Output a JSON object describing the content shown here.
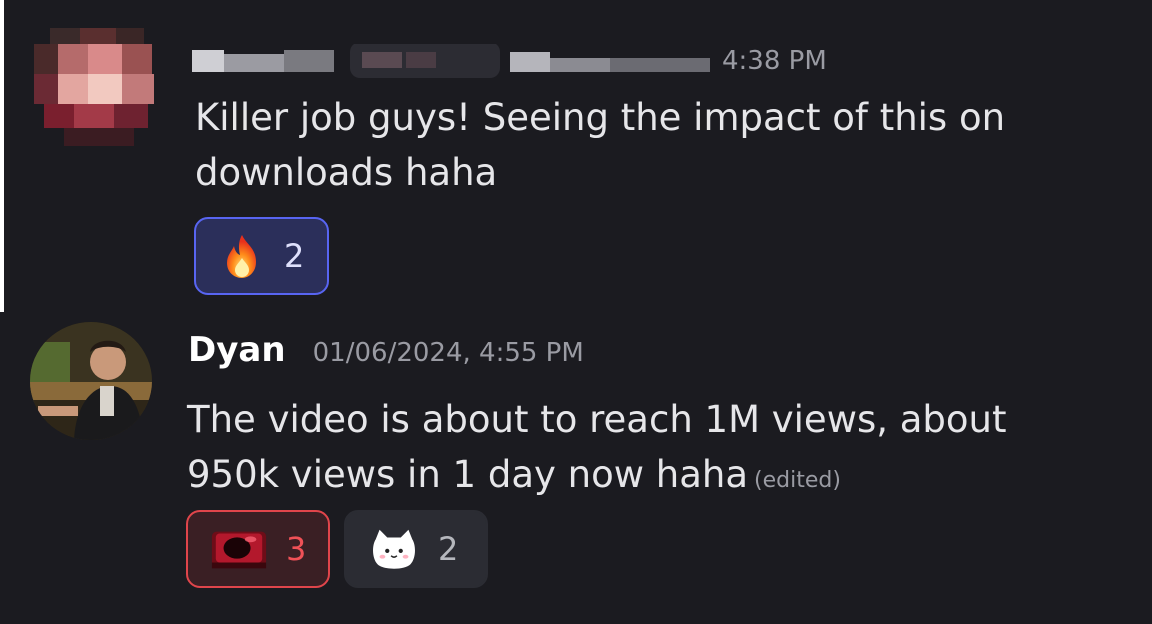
{
  "messages": [
    {
      "author": "",
      "timestamp": "4:38 PM",
      "lines": [
        "Killer job guys! Seeing the impact of this on",
        "downloads haha"
      ],
      "reactions": [
        {
          "emoji": "fire-emoji",
          "count": "2",
          "selected": true
        }
      ]
    },
    {
      "author": "Dyan",
      "timestamp": "01/06/2024, 4:55 PM",
      "lines": [
        "The video is about to reach 1M views, about",
        "950k views in 1 day now haha"
      ],
      "edited": "(edited)",
      "reactions": [
        {
          "emoji": "red-gem-emoji",
          "count": "3",
          "selected": true
        },
        {
          "emoji": "cat-emoji",
          "count": "2",
          "selected": false
        }
      ]
    }
  ],
  "colors": {
    "background": "#1b1b20",
    "text": "#e6e6e9",
    "muted": "#9a9ba3",
    "blurple": "#5865f2",
    "red": "#e0454b"
  }
}
